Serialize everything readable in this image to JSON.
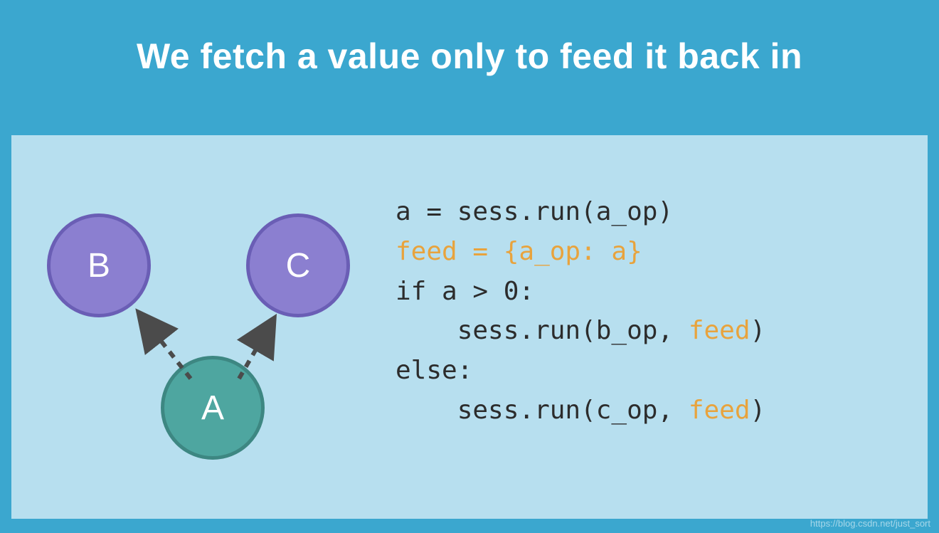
{
  "title": "We fetch a value only to feed it back in",
  "graph": {
    "nodeB": "B",
    "nodeC": "C",
    "nodeA": "A"
  },
  "code": {
    "l1": "a = sess.run(a_op)",
    "l2": "feed = {a_op: a}",
    "l3": "if a > 0:",
    "l4_pre": "    sess.run(b_op, ",
    "l4_hl": "feed",
    "l4_post": ")",
    "l5": "else:",
    "l6_pre": "    sess.run(c_op, ",
    "l6_hl": "feed",
    "l6_post": ")"
  },
  "watermark": "https://blog.csdn.net/just_sort"
}
